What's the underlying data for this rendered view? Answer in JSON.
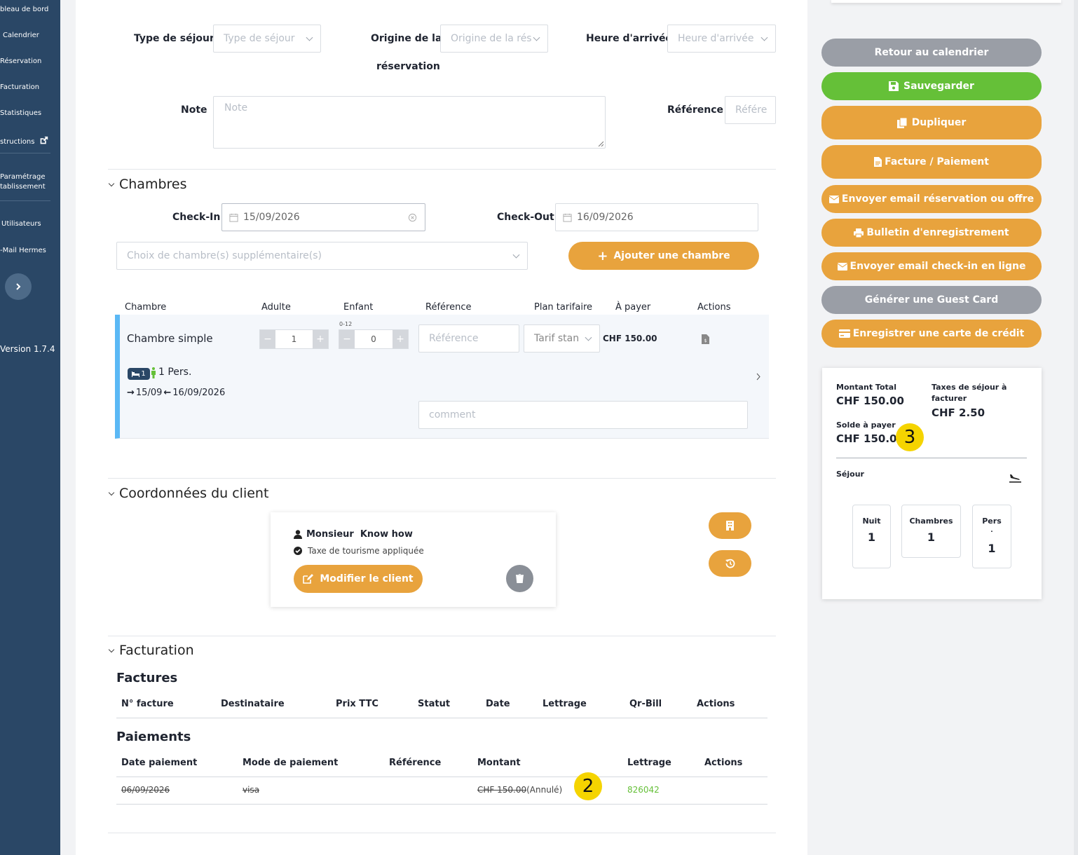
{
  "sidebar": {
    "items": [
      {
        "label": "bleau de bord"
      },
      {
        "label": "Calendrier"
      },
      {
        "label": "Réservation"
      },
      {
        "label": "Facturation"
      },
      {
        "label": "Statistiques"
      },
      {
        "label": "structions"
      },
      {
        "label": "Paramétrage"
      },
      {
        "label": "tablissement"
      },
      {
        "label": "Utilisateurs"
      },
      {
        "label": "-Mail Hermes"
      }
    ],
    "version": "Version 1.7.4"
  },
  "form": {
    "type_sejour_label": "Type de séjour",
    "type_sejour_placeholder": "Type de séjour",
    "origine_label_1": "Origine de la",
    "origine_label_2": "réservation",
    "origine_placeholder": "Origine de la rés",
    "heure_label": "Heure d'arrivée",
    "heure_placeholder": "Heure d'arrivée",
    "note_label": "Note",
    "note_placeholder": "Note",
    "reference_label": "Référence",
    "reference_placeholder": "Référe"
  },
  "chambres": {
    "title": "Chambres",
    "checkin_label": "Check-In",
    "checkin_value": "15/09/2026",
    "checkout_label": "Check-Out",
    "checkout_value": "16/09/2026",
    "choice_placeholder": "Choix de chambre(s) supplémentaire(s)",
    "add_button": "Ajouter une chambre",
    "columns": [
      "Chambre",
      "Adulte",
      "Enfant",
      "Référence",
      "Plan tarifaire",
      "À payer",
      "Actions"
    ],
    "row": {
      "name": "Chambre simple",
      "adults": "1",
      "children": "0",
      "children_hint": "0-12",
      "reference_placeholder": "Référence",
      "tarif": "Tarif stan",
      "price": "CHF 150.00",
      "bed_badge": "1",
      "persons": "1 Pers.",
      "date_from": "15/09",
      "date_to": "16/09/2026",
      "comment_placeholder": "comment"
    }
  },
  "client": {
    "title": "Coordonnées du client",
    "name": "Monsieur  Know how",
    "tax": "Taxe de tourisme appliquée",
    "edit_button": "Modifier le client"
  },
  "facturation": {
    "title": "Facturation",
    "factures_title": "Factures",
    "factures_columns": [
      "N° facture",
      "Destinataire",
      "Prix TTC",
      "Statut",
      "Date",
      "Lettrage",
      "Qr-Bill",
      "Actions"
    ],
    "paiements_title": "Paiements",
    "paiements_columns": [
      "Date paiement",
      "Mode de paiement",
      "Référence",
      "Montant",
      "Lettrage",
      "Actions"
    ],
    "payment": {
      "date": "06/09/2026",
      "mode": "visa",
      "amount": "CHF 150.00",
      "status": "(Annulé)",
      "lettrage": "826042"
    },
    "marker": "2"
  },
  "actions": {
    "retour": "Retour au calendrier",
    "sauvegarder": "Sauvegarder",
    "dupliquer": "Dupliquer",
    "facture": "Facture / Paiement",
    "email_reservation": "Envoyer email réservation ou offre",
    "bulletin": "Bulletin d'enregistrement",
    "email_checkin": "Envoyer email check-in en ligne",
    "guest_card": "Générer une Guest Card",
    "carte_credit": "Enregistrer une carte de crédit"
  },
  "summary": {
    "montant_total_label": "Montant Total",
    "montant_total_value": "CHF 150.00",
    "taxes_label_1": "Taxes de séjour à",
    "taxes_label_2": "facturer",
    "taxes_value": "CHF 2.50",
    "solde_label": "Solde à payer",
    "solde_value": "CHF 150.00",
    "marker": "3",
    "sejour_label": "Séjour",
    "nuit_label": "Nuit",
    "nuit_value": "1",
    "chambres_label": "Chambres",
    "chambres_value": "1",
    "pers_label": "Pers",
    "pers_dot": ".",
    "pers_value": "1"
  },
  "colors": {
    "sidebar": "#2a4766",
    "orange": "#e8a33d",
    "green": "#65c038",
    "grey": "#9a9ea6",
    "room_accent": "#5bb8f5"
  }
}
